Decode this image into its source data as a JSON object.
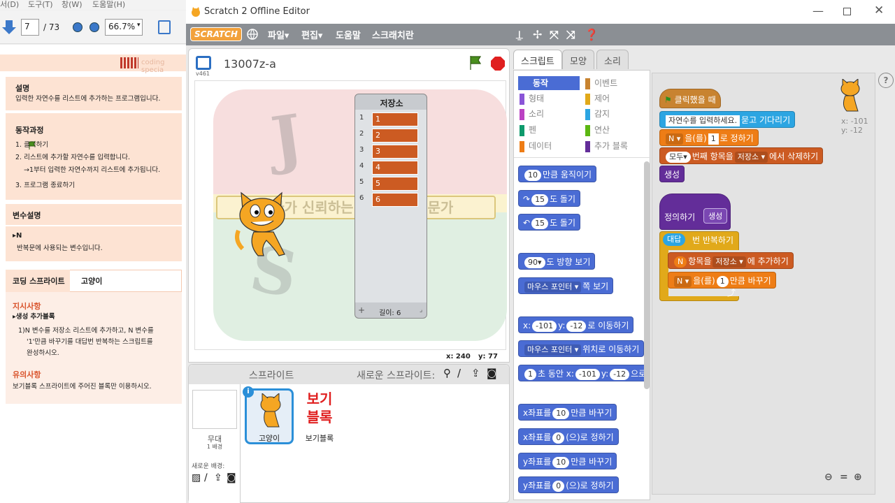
{
  "pdf": {
    "menu": [
      "서(D)",
      "도구(T)",
      "창(W)",
      "도움말(H)"
    ],
    "page_current": "7",
    "page_total": "/ 73",
    "zoom": "66.7%",
    "brand": "coding specia",
    "desc_title": "설명",
    "desc_body": "입력한 자연수를 리스트에 추가하는 프로그램입니다.",
    "process_title": "동작과정",
    "steps": [
      "1.  클릭하기",
      "2. 리스트에 추가할 자연수를 입력합니다.",
      "→1부터 입력한 자연수까지 리스트에 추가됩니다.",
      "3. 프로그램 종료하기"
    ],
    "var_title": "변수설명",
    "var_name": "▸N",
    "var_desc": "반복문에 사용되는 변수입니다.",
    "tab1": "코딩 스프라이트",
    "tab2": "고양이",
    "instr_title": "지시사항",
    "instr_sub": "▸생성 추가블록",
    "instr_body": [
      "1)N 변수를 저장소 리스트에 추가하고, N 변수를",
      "'1'만큼 바꾸기를 대답번 반복하는 스크립트를",
      "완성하시오."
    ],
    "note_title": "유의사항",
    "note_body": "보기블록 스프라이트에 주어진 블록만 이용하시오."
  },
  "window": {
    "title": "Scratch 2 Offline Editor",
    "logo": "SCRATCH",
    "menus": [
      "파일▾",
      "편집▾",
      "도움말",
      "스크래치란"
    ]
  },
  "stage": {
    "project_name": "13007z-a",
    "version": "v461",
    "list_title": "저장소",
    "list_items": [
      "1",
      "2",
      "3",
      "4",
      "5",
      "6"
    ],
    "list_length": "길이: 6",
    "watermark_banner": "엄마가 신뢰하는 코딩교육 전문가",
    "coords_x": "x: 240",
    "coords_y": "y: 77"
  },
  "sprites": {
    "header": "스프라이트",
    "new_sprite": "새로운 스프라이트:",
    "stage_label": "무대",
    "stage_sub": "1 배경",
    "new_backdrop": "새로운 배경:",
    "items": [
      {
        "name": "고양이"
      },
      {
        "name": "보기블록",
        "thumb_text": "보기\n블록"
      }
    ]
  },
  "tabs": [
    "스크립트",
    "모양",
    "소리"
  ],
  "categories": [
    {
      "label": "동작",
      "color": "#4a6cd4",
      "selected": true
    },
    {
      "label": "이벤트",
      "color": "#c88330"
    },
    {
      "label": "형태",
      "color": "#8a55d7"
    },
    {
      "label": "제어",
      "color": "#e1a91a"
    },
    {
      "label": "소리",
      "color": "#bb42c3"
    },
    {
      "label": "감지",
      "color": "#2ca5e2"
    },
    {
      "label": "펜",
      "color": "#0e9a6c"
    },
    {
      "label": "연산",
      "color": "#5cb712"
    },
    {
      "label": "데이터",
      "color": "#ee7d16"
    },
    {
      "label": "추가 블록",
      "color": "#632d99"
    }
  ],
  "palette": {
    "move": [
      "10",
      "만큼 움직이기"
    ],
    "turn_r": [
      "15",
      "도 돌기"
    ],
    "turn_l": [
      "15",
      "도 돌기"
    ],
    "point_dir": [
      "90▾",
      "도 방향 보기"
    ],
    "point_toward": [
      "마우스 포인터 ▾",
      "쪽 보기"
    ],
    "goto_xy": [
      "x:",
      "-101",
      "y:",
      "-12",
      "로 이동하기"
    ],
    "goto": [
      "마우스 포인터 ▾",
      "위치로 이동하기"
    ],
    "glide": [
      "1",
      "초 동안 x:",
      "-101",
      "y:",
      "-12",
      "으로"
    ],
    "change_x": [
      "x좌표를",
      "10",
      "만큼 바꾸기"
    ],
    "set_x": [
      "x좌표를",
      "0",
      "(으)로 정하기"
    ],
    "change_y": [
      "y좌표를",
      "10",
      "만큼 바꾸기"
    ],
    "set_y": [
      "y좌표를",
      "0",
      "(으)로 정하기"
    ]
  },
  "script": {
    "hat": "클릭했을 때",
    "ask": [
      "자연수를 입력하세요.",
      "묻고 기다리기"
    ],
    "set_var": [
      "N ▾",
      "을(를)",
      "1",
      "로 정하기"
    ],
    "delete": [
      "모두▾",
      "번째 항목을",
      "저장소 ▾",
      "에서 삭제하기"
    ],
    "call": "생성",
    "define": "정의하기",
    "define_name": "생성",
    "repeat": [
      "대답",
      "번 반복하기"
    ],
    "add": [
      "N",
      "항목을",
      "저장소 ▾",
      "에 추가하기"
    ],
    "change": [
      "N ▾",
      "을(를)",
      "1",
      "만큼 바꾸기"
    ],
    "sprite_x": "x: -101",
    "sprite_y": "y: -12"
  }
}
